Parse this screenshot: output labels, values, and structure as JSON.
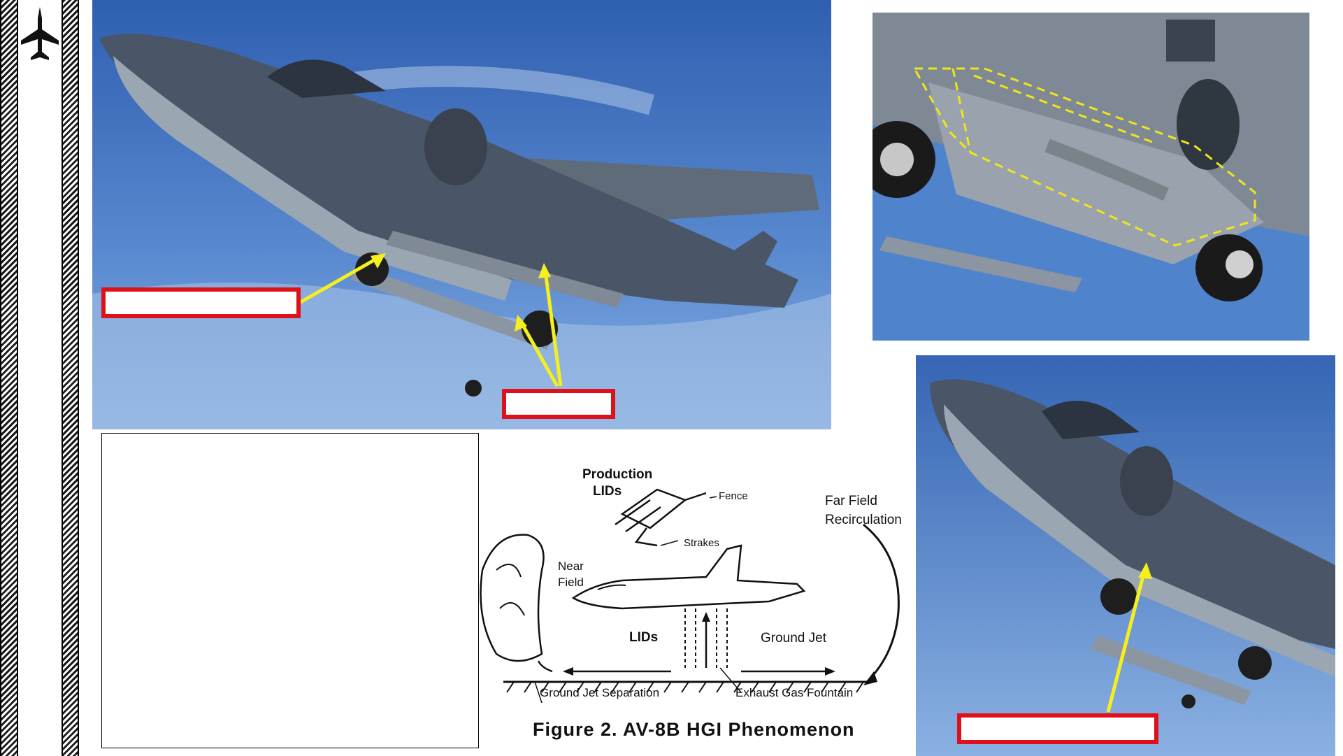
{
  "sidebar": {
    "logo_icon": "jet-aircraft-icon",
    "pattern": "diagonal-hatch"
  },
  "photos": {
    "main": {
      "subject": "AV-8B Harrier hovering, underside view",
      "highlight_color": "#e0101a",
      "arrow_color": "#f5ef1e"
    },
    "top_right": {
      "subject": "close-up of fuselage strakes outlined with dashed yellow line",
      "outline_color": "#f0e51a"
    },
    "bottom_right": {
      "subject": "AV-8B underside, nose section"
    }
  },
  "callouts": {
    "count": 3,
    "border_color": "#e0101a"
  },
  "text_panel": {
    "content": ""
  },
  "diagram": {
    "labels": {
      "production": "Production",
      "lids_top": "LIDs",
      "fence": "Fence",
      "strakes": "Strakes",
      "far_field_1": "Far Field",
      "far_field_2": "Recirculation",
      "near_1": "Near",
      "near_2": "Field",
      "lids_bottom": "LIDs",
      "ground_jet": "Ground Jet",
      "ground_jet_sep": "Ground Jet Separation",
      "exhaust_fountain": "Exhaust Gas Fountain"
    },
    "caption": "Figure 2.   AV-8B HGI Phenomenon"
  }
}
